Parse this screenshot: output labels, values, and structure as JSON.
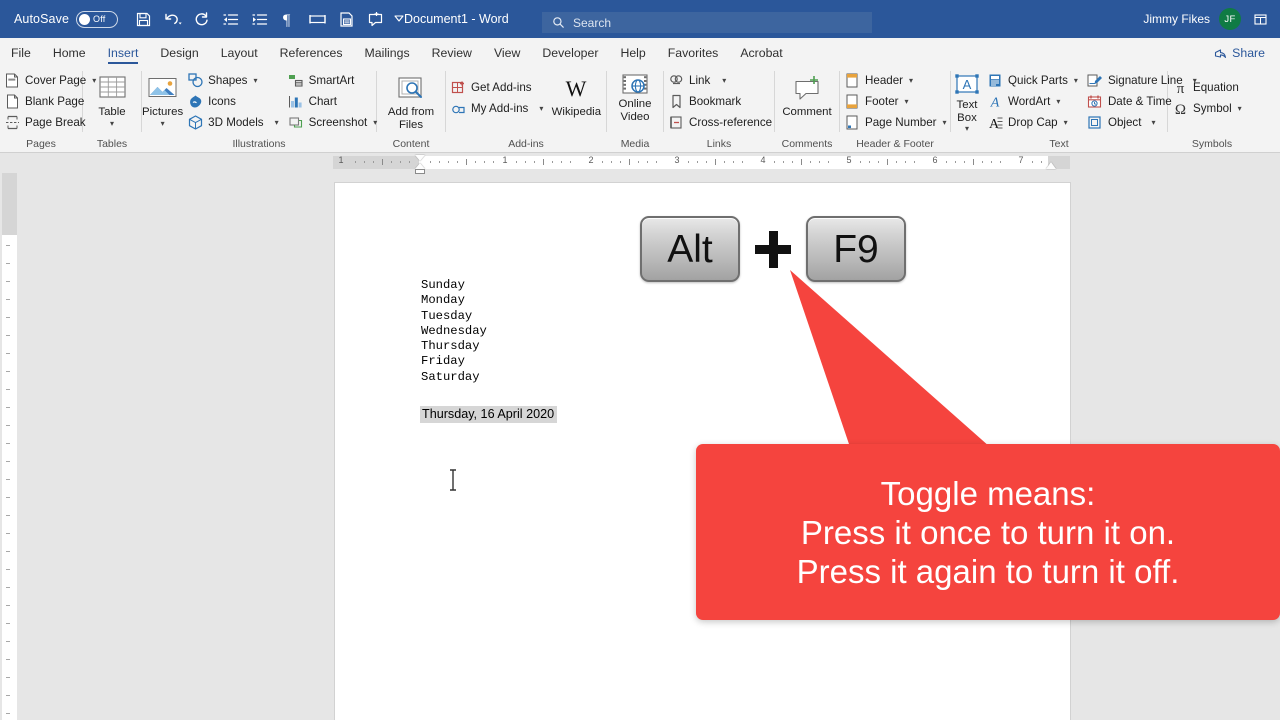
{
  "titlebar": {
    "autosave_label": "AutoSave",
    "autosave_state": "Off",
    "document_title": "Document1  -  Word",
    "search_placeholder": "Search",
    "user_name": "Jimmy Fikes",
    "user_initials": "JF",
    "quick_access": [
      {
        "name": "save-icon",
        "label": "Save"
      },
      {
        "name": "undo-icon",
        "label": "Undo"
      },
      {
        "name": "redo-icon",
        "label": "Redo"
      },
      {
        "name": "decrease-indent-icon",
        "label": "Decrease Indent"
      },
      {
        "name": "increase-indent-icon",
        "label": "Increase Indent"
      },
      {
        "name": "formatting-marks-icon",
        "label": "Show/Hide Formatting Marks"
      },
      {
        "name": "insert-text-box-icon",
        "label": "Text Box"
      },
      {
        "name": "print-preview-icon",
        "label": "Print Preview and Print"
      },
      {
        "name": "new-comment-icon",
        "label": "New Comment"
      },
      {
        "name": "customize-qat-caret-icon",
        "label": "Customize Quick Access Toolbar"
      }
    ]
  },
  "tabs": [
    {
      "label": "File",
      "active": false
    },
    {
      "label": "Home",
      "active": false
    },
    {
      "label": "Insert",
      "active": true
    },
    {
      "label": "Design",
      "active": false
    },
    {
      "label": "Layout",
      "active": false
    },
    {
      "label": "References",
      "active": false
    },
    {
      "label": "Mailings",
      "active": false
    },
    {
      "label": "Review",
      "active": false
    },
    {
      "label": "View",
      "active": false
    },
    {
      "label": "Developer",
      "active": false
    },
    {
      "label": "Help",
      "active": false
    },
    {
      "label": "Favorites",
      "active": false
    },
    {
      "label": "Acrobat",
      "active": false
    }
  ],
  "share_label": "Share",
  "ribbon": {
    "groups": [
      {
        "label": "Pages",
        "items": [
          {
            "label": "Cover Page",
            "icon": "cover-page-icon",
            "caret": true
          },
          {
            "label": "Blank Page",
            "icon": "blank-page-icon",
            "caret": false
          },
          {
            "label": "Page Break",
            "icon": "page-break-icon",
            "caret": false
          }
        ]
      },
      {
        "label": "Tables",
        "items": [
          {
            "label": "Table",
            "icon": "table-icon",
            "caret": true,
            "big": true
          }
        ]
      },
      {
        "label": "Illustrations",
        "items": [
          {
            "label": "Pictures",
            "icon": "pictures-icon",
            "caret": true,
            "big": true
          },
          {
            "label": "Shapes",
            "icon": "shapes-icon",
            "caret": true
          },
          {
            "label": "Icons",
            "icon": "icons-icon",
            "caret": false
          },
          {
            "label": "3D Models",
            "icon": "3d-models-icon",
            "caret": true
          },
          {
            "label": "SmartArt",
            "icon": "smartart-icon",
            "caret": false
          },
          {
            "label": "Chart",
            "icon": "chart-icon",
            "caret": false
          },
          {
            "label": "Screenshot",
            "icon": "screenshot-icon",
            "caret": true
          }
        ]
      },
      {
        "label": "Content",
        "items": [
          {
            "label": "Add from Files",
            "icon": "add-from-files-icon",
            "caret": true,
            "big": true
          }
        ]
      },
      {
        "label": "Add-ins",
        "items": [
          {
            "label": "Get Add-ins",
            "icon": "get-add-ins-icon",
            "caret": false
          },
          {
            "label": "My Add-ins",
            "icon": "my-add-ins-icon",
            "caret": true
          },
          {
            "label": "Wikipedia",
            "icon": "wikipedia-icon",
            "caret": false,
            "big": true
          }
        ]
      },
      {
        "label": "Media",
        "items": [
          {
            "label": "Online Video",
            "icon": "online-video-icon",
            "caret": false,
            "big": true
          }
        ]
      },
      {
        "label": "Links",
        "items": [
          {
            "label": "Link",
            "icon": "link-icon",
            "caret": true
          },
          {
            "label": "Bookmark",
            "icon": "bookmark-icon",
            "caret": false
          },
          {
            "label": "Cross-reference",
            "icon": "cross-reference-icon",
            "caret": false
          }
        ]
      },
      {
        "label": "Comments",
        "items": [
          {
            "label": "Comment",
            "icon": "comment-icon",
            "caret": false,
            "big": true
          }
        ]
      },
      {
        "label": "Header & Footer",
        "items": [
          {
            "label": "Header",
            "icon": "header-icon",
            "caret": true
          },
          {
            "label": "Footer",
            "icon": "footer-icon",
            "caret": true
          },
          {
            "label": "Page Number",
            "icon": "page-number-icon",
            "caret": true
          }
        ]
      },
      {
        "label": "Text",
        "items": [
          {
            "label": "Text Box",
            "icon": "text-box-icon",
            "caret": true,
            "big": true
          },
          {
            "label": "Quick Parts",
            "icon": "quick-parts-icon",
            "caret": true
          },
          {
            "label": "WordArt",
            "icon": "wordart-icon",
            "caret": true
          },
          {
            "label": "Drop Cap",
            "icon": "drop-cap-icon",
            "caret": true
          },
          {
            "label": "Signature Line",
            "icon": "signature-line-icon",
            "caret": true
          },
          {
            "label": "Date & Time",
            "icon": "date-time-icon",
            "caret": false
          },
          {
            "label": "Object",
            "icon": "object-icon",
            "caret": true
          }
        ]
      },
      {
        "label": "Symbols",
        "items": [
          {
            "label": "Equation",
            "icon": "equation-icon",
            "caret": false
          },
          {
            "label": "Symbol",
            "icon": "symbol-icon",
            "caret": true
          }
        ]
      }
    ]
  },
  "ruler": {
    "horizontal_numbers": [
      "1",
      "1",
      "2",
      "3",
      "4",
      "5",
      "6",
      "7"
    ],
    "left_indent_marker": "indent-markers",
    "right_indent_marker": "right-indent-marker"
  },
  "document": {
    "body_text": "Sunday\nMonday\nTuesday\nWednesday\nThursday\nFriday\nSaturday",
    "date_field": "Thursday, 16 April 2020"
  },
  "overlay": {
    "key_left": "Alt",
    "key_plus": "+",
    "key_right": "F9",
    "callout_lines": [
      "Toggle means:",
      "Press it once to turn it on.",
      "Press it again to turn it off."
    ],
    "callout_color": "#f5443e",
    "arrow_color": "#f5443e"
  }
}
